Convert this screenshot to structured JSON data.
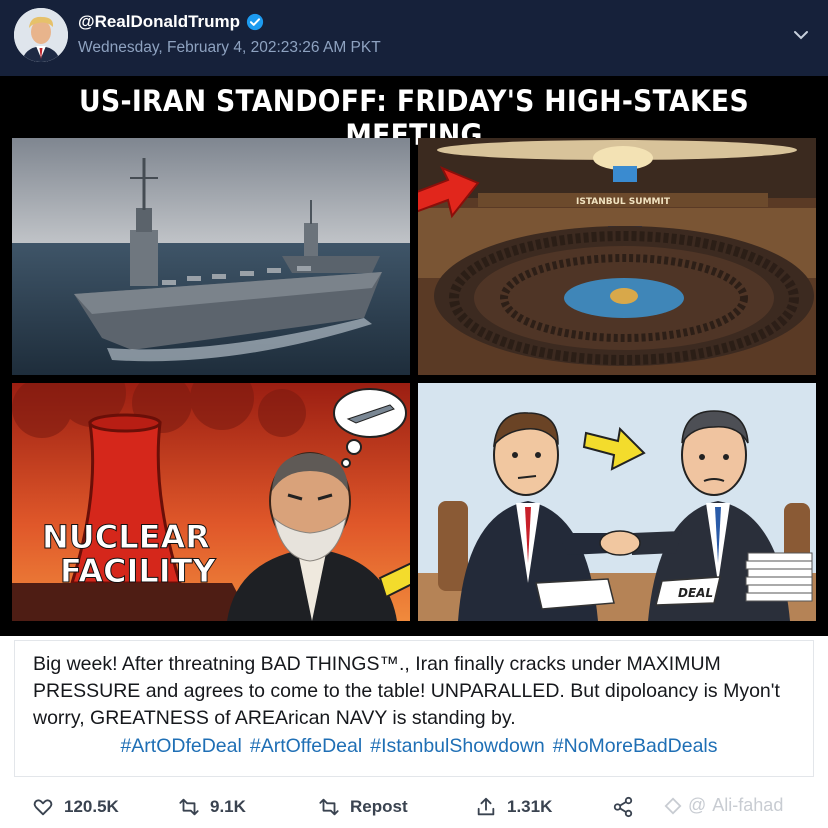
{
  "header": {
    "handle": "@RealDonaldTrump",
    "timestamp": "Wednesday, February 4, 202:23:26 AM PKT",
    "verified_color": "#1d9bf0"
  },
  "media": {
    "headline": "US-IRAN STANDOFF: FRIDAY'S HIGH-STAKES MEETING",
    "summit_sign": "ISTANBUL SUMMIT",
    "nuclear_label_line1": "NUCLEAR",
    "nuclear_label_line2": "FACILITY",
    "deal_label": "DEAL"
  },
  "tweet": {
    "text": "Big week! After threatning BAD THINGS™.,  Iran  finally cracks under MAXIMUM PRESSURE and agrees to come to the table! UNPARALLED. But dipoloancy is Myon't worry, GREATNESS of AREArican NAVY is standing by.",
    "hashtags": [
      "#ArtODfeDeal",
      "#ArtOffeDeal",
      "#IstanbulShowdown",
      "#NoMoreBadDeals"
    ],
    "hashtag_color": "#1f6fb5"
  },
  "actions": {
    "likes": "120.5K",
    "retweets": "9.1K",
    "repost_label": "Repost",
    "shares": "1.31K"
  },
  "watermark": "Ali-fahad"
}
